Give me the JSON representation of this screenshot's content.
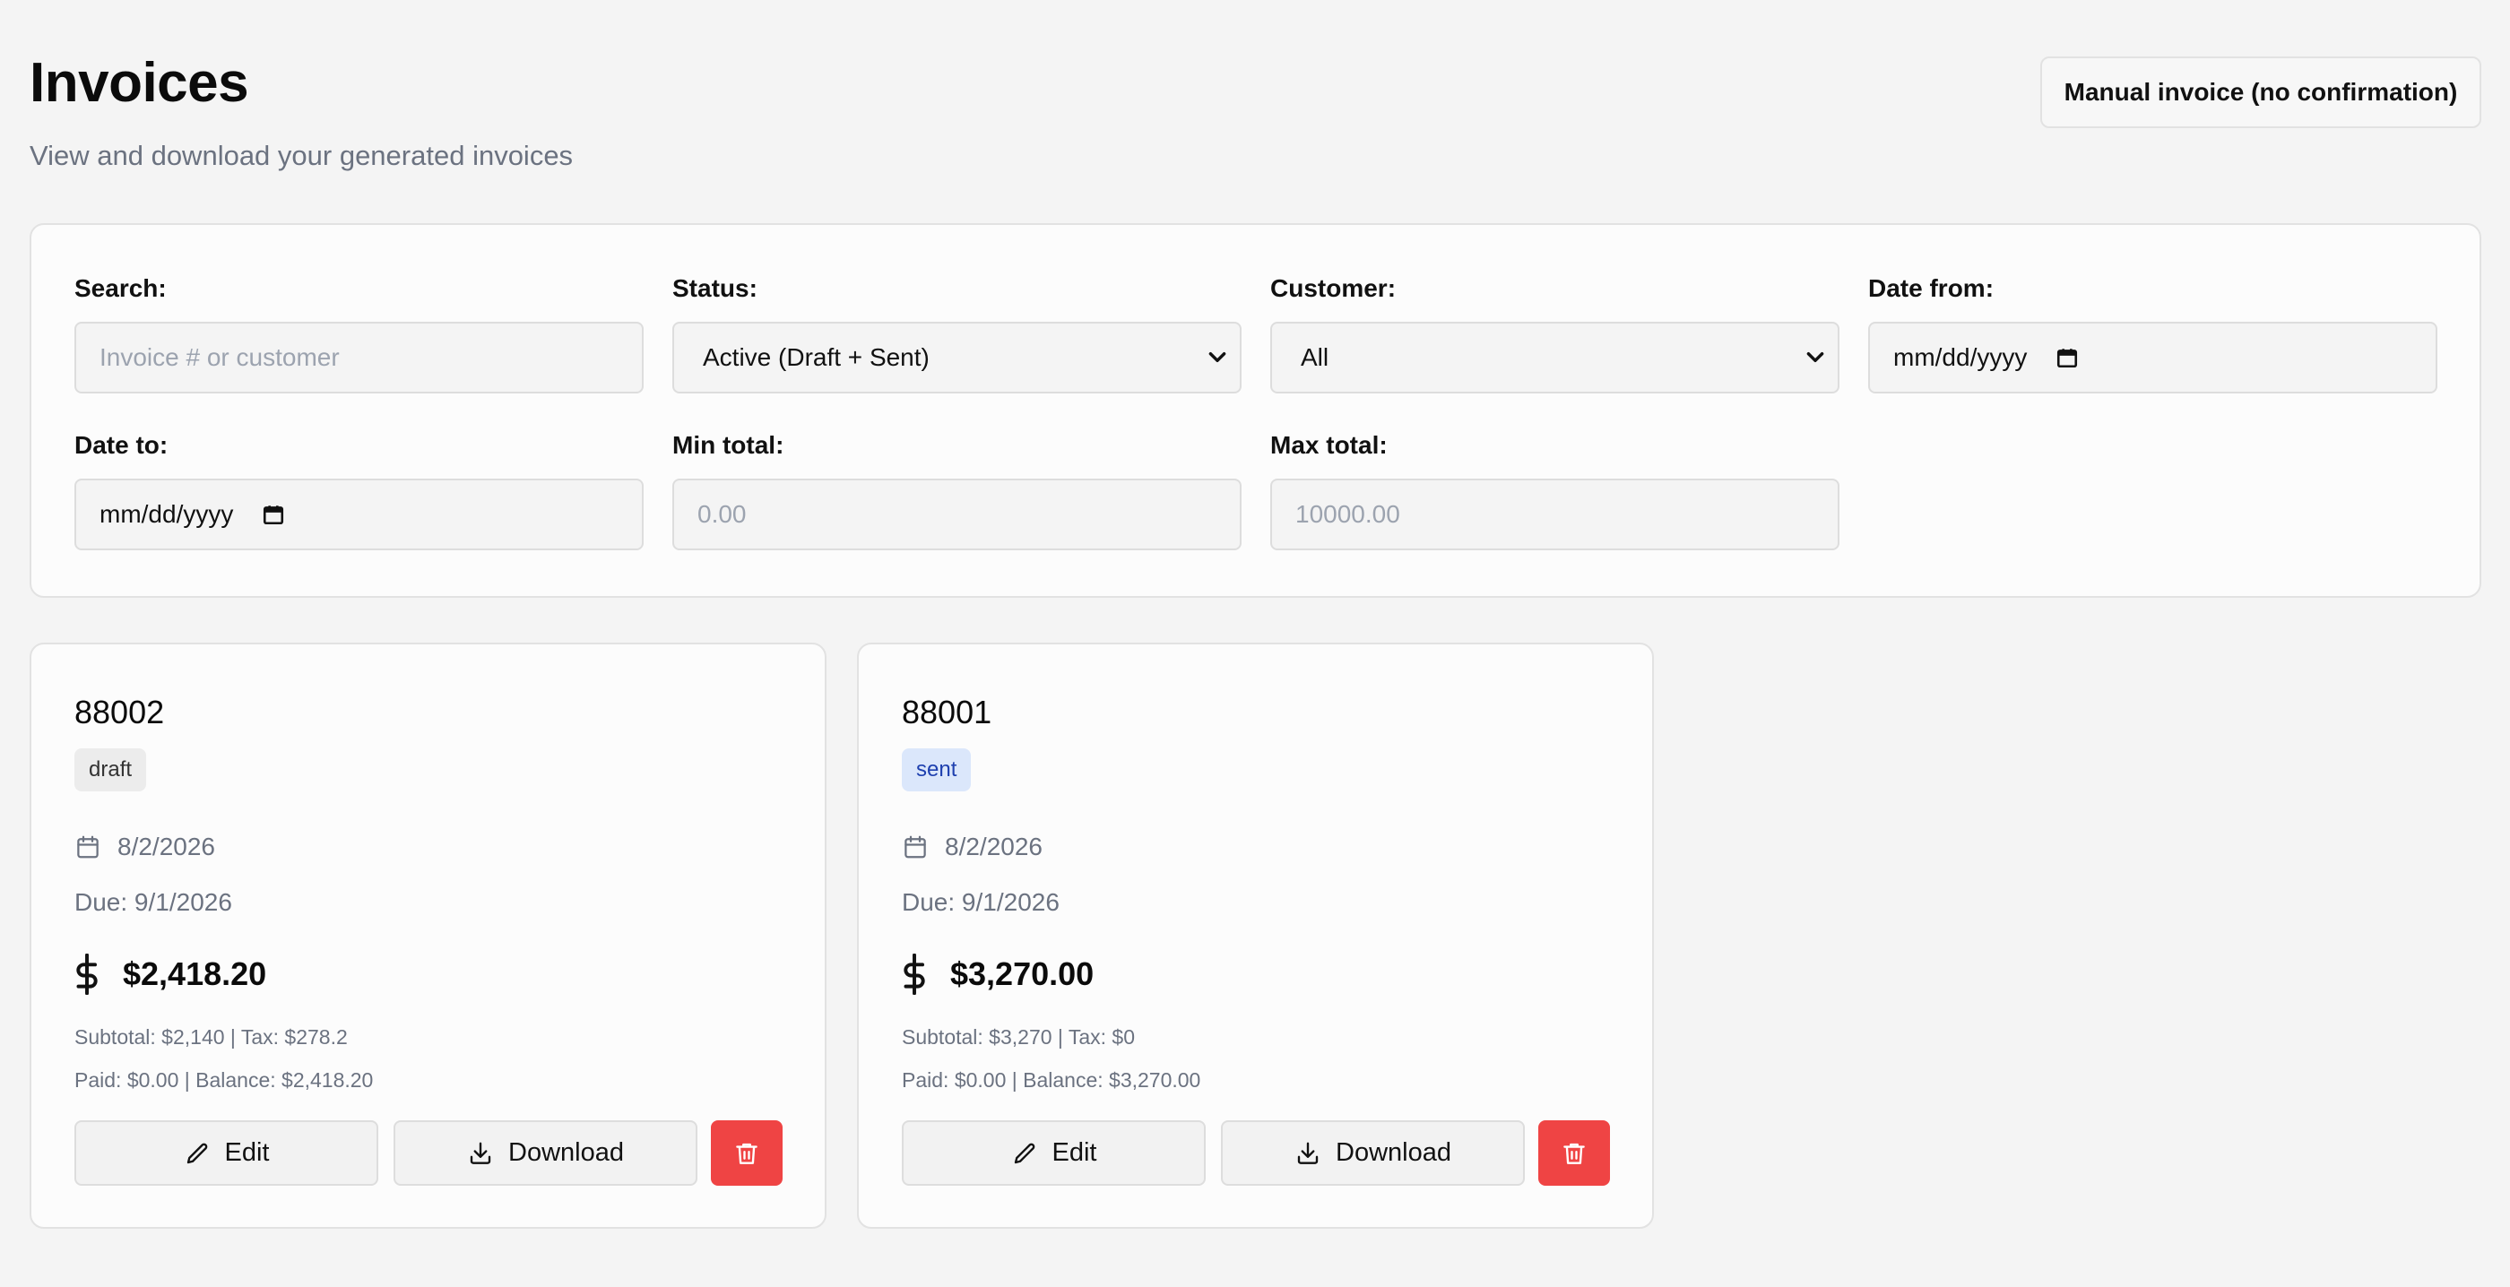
{
  "header": {
    "title": "Invoices",
    "subtitle": "View and download your generated invoices",
    "manual_button": "Manual invoice (no confirmation)"
  },
  "filters": {
    "search": {
      "label": "Search:",
      "placeholder": "Invoice # or customer"
    },
    "status": {
      "label": "Status:",
      "value": "Active (Draft + Sent)"
    },
    "customer": {
      "label": "Customer:",
      "value": "All"
    },
    "date_from": {
      "label": "Date from:",
      "value": "mm/dd/yyyy"
    },
    "date_to": {
      "label": "Date to:",
      "value": "mm/dd/yyyy"
    },
    "min_total": {
      "label": "Min total:",
      "placeholder": "0.00"
    },
    "max_total": {
      "label": "Max total:",
      "placeholder": "10000.00"
    }
  },
  "invoices": [
    {
      "number": "88002",
      "status": "draft",
      "date": "8/2/2026",
      "due": "Due: 9/1/2026",
      "total": "$2,418.20",
      "subtotal_tax": "Subtotal: $2,140 | Tax: $278.2",
      "paid_balance": "Paid: $0.00 | Balance: $2,418.20",
      "edit_label": "Edit",
      "download_label": "Download"
    },
    {
      "number": "88001",
      "status": "sent",
      "date": "8/2/2026",
      "due": "Due: 9/1/2026",
      "total": "$3,270.00",
      "subtotal_tax": "Subtotal: $3,270 | Tax: $0",
      "paid_balance": "Paid: $0.00 | Balance: $3,270.00",
      "edit_label": "Edit",
      "download_label": "Download"
    }
  ],
  "colors": {
    "background": "#f4f4f4",
    "danger": "#ef4444",
    "draft_badge": "#ececec",
    "sent_badge": "#dbe7fb",
    "muted_text": "#6b7280"
  },
  "icons": [
    "calendar-icon",
    "dollar-icon",
    "pencil-icon",
    "download-icon",
    "trash-icon",
    "chevron-down-icon"
  ]
}
